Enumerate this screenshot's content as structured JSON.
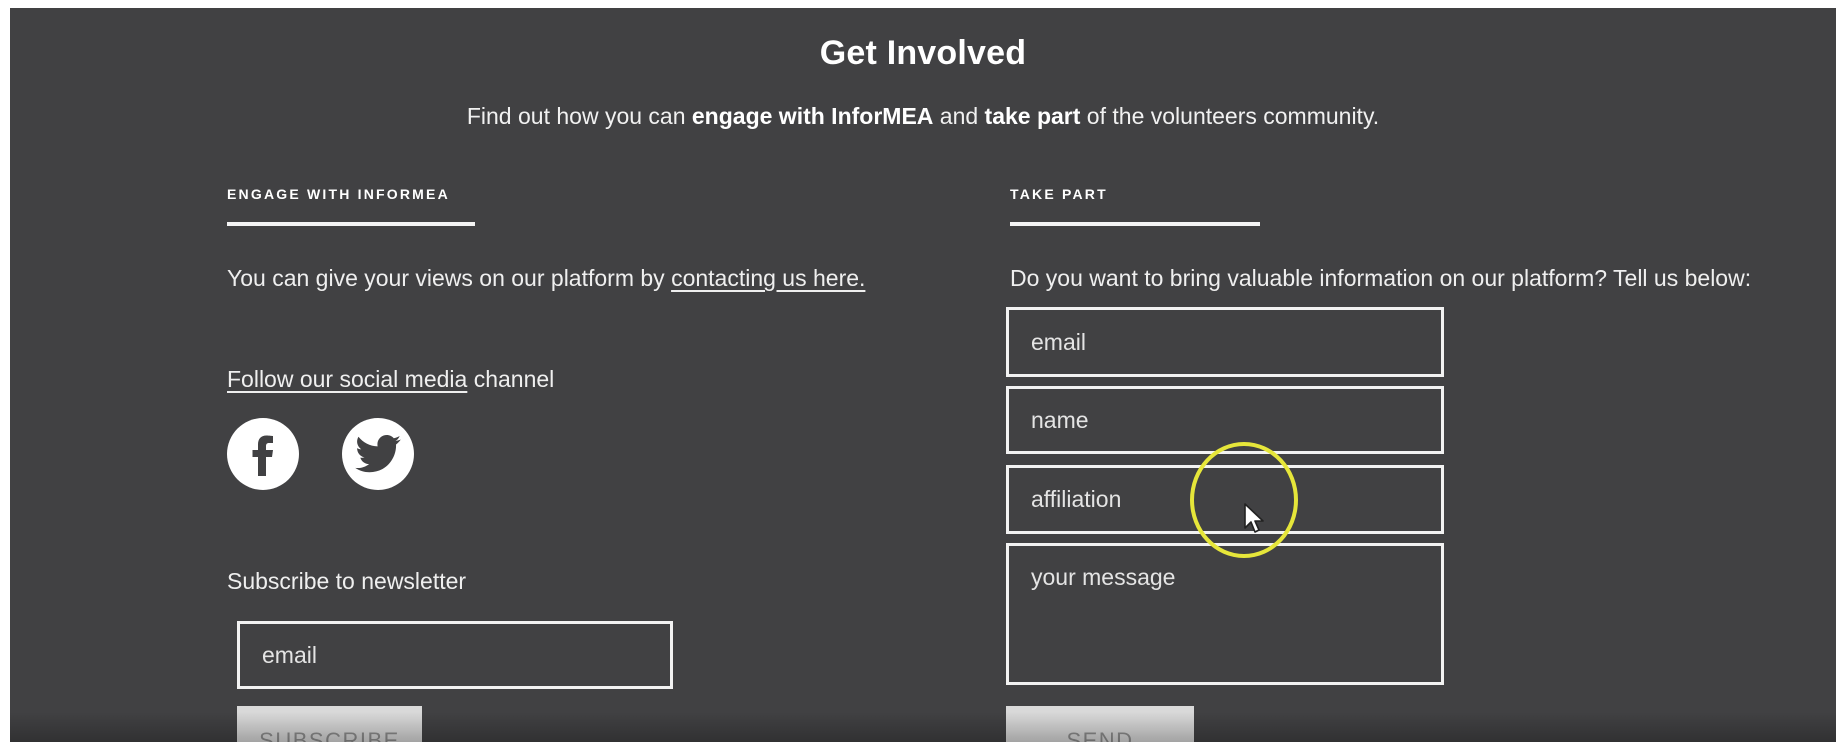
{
  "header": {
    "title": "Get Involved",
    "intro": {
      "part1": "Find out how you can ",
      "bold1": "engage with InforMEA",
      "part2": " and ",
      "bold2": "take part",
      "part3": " of the volunteers community."
    }
  },
  "engage": {
    "heading": "ENGAGE WITH INFORMEA",
    "views_text": "You can give your views on our platform by ",
    "contact_link": "contacting us here.",
    "social_link": "Follow our social media",
    "social_text": " channel",
    "social_icons": [
      "facebook-icon",
      "twitter-icon"
    ],
    "newsletter_label": "Subscribe to newsletter",
    "newsletter_placeholder": "email",
    "subscribe_label": "SUBSCRIBE"
  },
  "take_part": {
    "heading": "TAKE PART",
    "prompt": "Do you want to bring valuable information on our platform? Tell us below:",
    "email_placeholder": "email",
    "name_placeholder": "name",
    "affiliation_placeholder": "affiliation",
    "message_placeholder": "your message",
    "send_label": "SEND"
  },
  "colors": {
    "background": "#414143",
    "text": "#ffffff",
    "button": "#d9d9d9",
    "cursor_highlight": "#e6e63a"
  }
}
